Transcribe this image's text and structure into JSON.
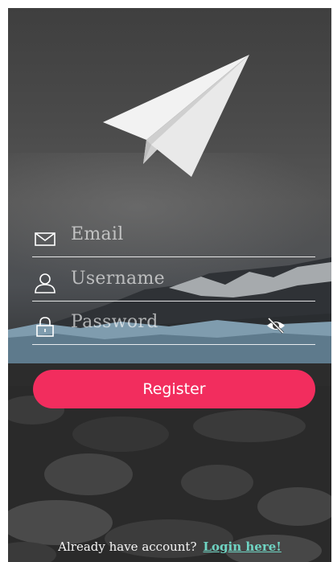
{
  "colors": {
    "accent": "#f22d5e",
    "link": "#6fd4c3",
    "text_light": "#ffffff"
  },
  "form": {
    "email": {
      "placeholder": "Email",
      "icon": "envelope-icon"
    },
    "username": {
      "placeholder": "Username",
      "icon": "user-icon"
    },
    "password": {
      "placeholder": "Password",
      "icon": "lock-icon",
      "toggle_icon": "eye-slash-icon"
    }
  },
  "register_label": "Register",
  "footer": {
    "prompt": "Already have account?",
    "link": "Login here!"
  },
  "logo_icon": "paper-plane-icon"
}
